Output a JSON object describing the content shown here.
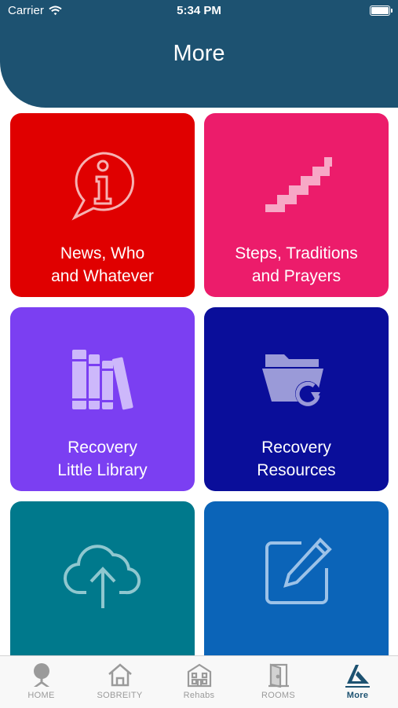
{
  "status_bar": {
    "carrier": "Carrier",
    "time": "5:34 PM"
  },
  "header": {
    "title": "More"
  },
  "tiles": [
    {
      "label_line1": "News, Who",
      "label_line2": "and Whatever",
      "icon": "info-speech-bubble-icon",
      "color": "#e00000"
    },
    {
      "label_line1": "Steps, Traditions",
      "label_line2": "and Prayers",
      "icon": "stairs-icon",
      "color": "#ec1c6b"
    },
    {
      "label_line1": "Recovery",
      "label_line2": "Little Library",
      "icon": "books-icon",
      "color": "#7b3ff2"
    },
    {
      "label_line1": "Recovery",
      "label_line2": "Resources",
      "icon": "folder-refresh-icon",
      "color": "#0a0e9a"
    },
    {
      "label_line1": "",
      "label_line2": "",
      "icon": "cloud-upload-icon",
      "color": "#00798c"
    },
    {
      "label_line1": "",
      "label_line2": "",
      "icon": "edit-icon",
      "color": "#0b64b8"
    }
  ],
  "tab_bar": {
    "items": [
      {
        "label": "HOME",
        "icon": "chair-icon"
      },
      {
        "label": "SOBREITY",
        "icon": "house-icon"
      },
      {
        "label": "Rehabs",
        "icon": "building-icon"
      },
      {
        "label": "ROOMS",
        "icon": "door-icon"
      },
      {
        "label": "More",
        "icon": "more-logo-icon",
        "active": true
      }
    ]
  },
  "colors": {
    "header": "#1d5271",
    "tab_active": "#1d5271",
    "tab_inactive": "#9a9a9a"
  }
}
